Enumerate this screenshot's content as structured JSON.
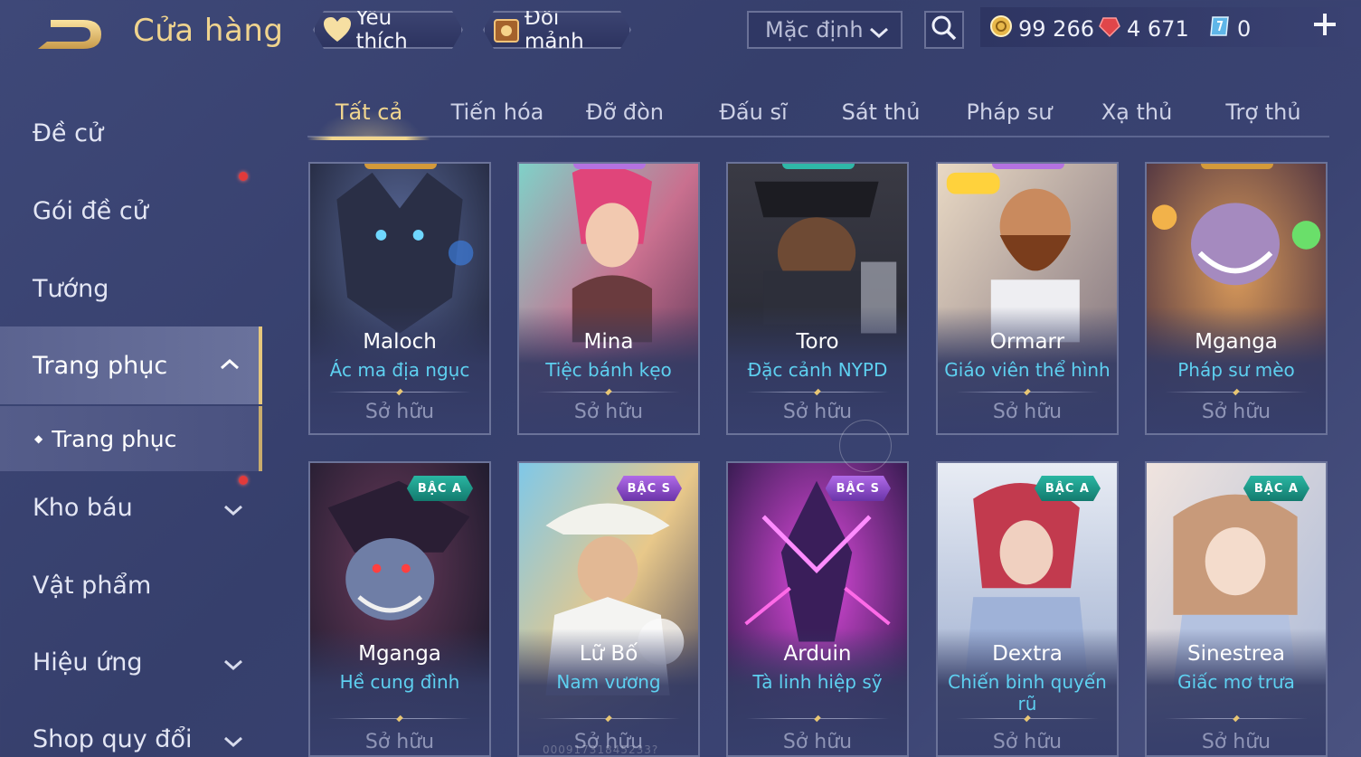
{
  "header": {
    "title": "Cửa hàng",
    "favorites_label": "Yêu thích",
    "exchange_label": "Đổi mảnh",
    "sort_value": "Mặc định",
    "currencies": [
      {
        "name": "gold-coin-icon",
        "value": "99 266"
      },
      {
        "name": "ruby-icon",
        "value": "4 671"
      },
      {
        "name": "voucher-icon",
        "value": "0"
      }
    ]
  },
  "sidebar": {
    "items": [
      {
        "label": "Đề cử"
      },
      {
        "label": "Gói đề cử"
      },
      {
        "label": "Tướng"
      },
      {
        "label": "Trang phục"
      },
      {
        "label": "Trang phục"
      },
      {
        "label": "Kho báu"
      },
      {
        "label": "Vật phẩm"
      },
      {
        "label": "Hiệu ứng"
      },
      {
        "label": "Shop quy đổi"
      }
    ]
  },
  "tabs": [
    "Tất cả",
    "Tiến hóa",
    "Đỡ đòn",
    "Đấu sĩ",
    "Sát thủ",
    "Pháp sư",
    "Xạ thủ",
    "Trợ thủ"
  ],
  "cards": [
    {
      "hero": "Maloch",
      "skin": "Ác ma địa ngục",
      "status": "Sở hữu",
      "badge": ""
    },
    {
      "hero": "Mina",
      "skin": "Tiệc bánh kẹo",
      "status": "Sở hữu",
      "badge": ""
    },
    {
      "hero": "Toro",
      "skin": "Đặc cảnh NYPD",
      "status": "Sở hữu",
      "badge": ""
    },
    {
      "hero": "Ormarr",
      "skin": "Giáo viên thể hình",
      "status": "Sở hữu",
      "badge": ""
    },
    {
      "hero": "Mganga",
      "skin": "Pháp sư mèo",
      "status": "Sở hữu",
      "badge": ""
    },
    {
      "hero": "Mganga",
      "skin": "Hề cung đình",
      "status": "Sở hữu",
      "badge": "BẬC A"
    },
    {
      "hero": "Lữ Bố",
      "skin": "Nam vương",
      "status": "Sở hữu",
      "badge": "BẬC S"
    },
    {
      "hero": "Arduin",
      "skin": "Tà linh hiệp sỹ",
      "status": "Sở hữu",
      "badge": "BẬC S"
    },
    {
      "hero": "Dextra",
      "skin": "Chiến binh quyến rũ",
      "status": "Sở hữu",
      "badge": "BẬC A"
    },
    {
      "hero": "Sinestrea",
      "skin": "Giấc mơ trưa",
      "status": "Sở hữu",
      "badge": "BẬC A"
    }
  ],
  "watermark": "00091731845233?",
  "colors": {
    "accent_gold": "#f1d68f",
    "skin_name": "#5ed0f0",
    "status": "#8f95b6",
    "notif": "#e23a3a"
  }
}
